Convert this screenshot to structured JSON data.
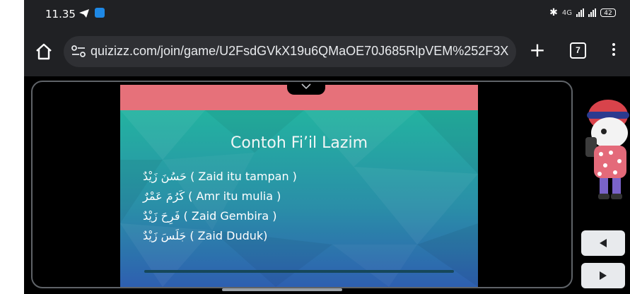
{
  "status_bar": {
    "time": "11.35",
    "network": "4G",
    "battery": "42",
    "icons": [
      "telegram-icon",
      "app-badge-icon",
      "bluetooth-icon",
      "signal-icon",
      "battery-icon"
    ]
  },
  "browser": {
    "url": "quizizz.com/join/game/U2FsdGVkX19u6QMaOE70J685RlpVEM%252F3X",
    "tab_count": "7",
    "icons": [
      "home-icon",
      "site-settings-icon",
      "plus-icon",
      "tab-switcher-icon",
      "more-vert-icon"
    ]
  },
  "slide": {
    "title": "Contoh Fi’il Lazim",
    "examples": [
      {
        "arabic": "حَسُنَ زَيْدٌ",
        "meaning": " ( Zaid itu tampan )"
      },
      {
        "arabic": "كَرُمَ عَمْرٌ",
        "meaning": " ( Amr itu mulia )"
      },
      {
        "arabic": "فَرِحَ زَيْدٌ",
        "meaning": " ( Zaid Gembira )"
      },
      {
        "arabic": "جَلَسَ زَيْدٌ",
        "meaning": " ( Zaid Duduk)"
      }
    ],
    "colors": {
      "top_band": "#e6717a",
      "gradient_top": "#23b3a0",
      "gradient_bottom": "#2e5fb0"
    }
  },
  "controls": {
    "icons": [
      "chevron-down-icon",
      "prev-arrow-icon",
      "next-arrow-icon"
    ]
  }
}
